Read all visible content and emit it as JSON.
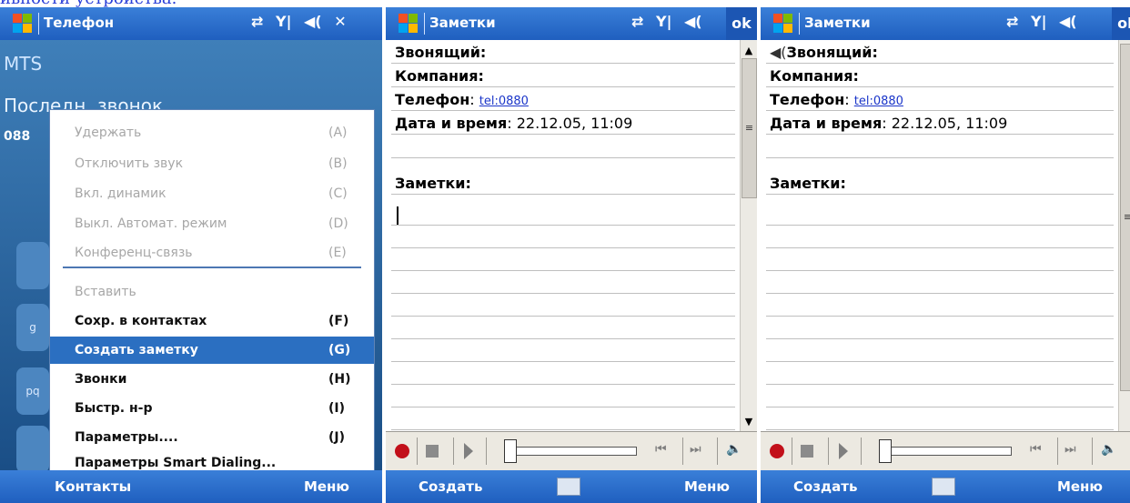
{
  "caption": "ивности устройства.",
  "screens": {
    "phone": {
      "title": "Телефон",
      "operator": "MTS",
      "last_calls": "Последн. звонок",
      "number_partial": "088",
      "keypad_chars": [
        "g",
        "pq"
      ],
      "menu": {
        "items": [
          {
            "label": "Удержать",
            "key": "(A)",
            "state": "disabled"
          },
          {
            "label": "Отключить звук",
            "key": "(B)",
            "state": "disabled"
          },
          {
            "label": "Вкл. динамик",
            "key": "(C)",
            "state": "disabled"
          },
          {
            "label": "Выкл. Автомат. режим",
            "key": "(D)",
            "state": "disabled"
          },
          {
            "label": "Конференц-связь",
            "key": "(E)",
            "state": "disabled"
          },
          {
            "label": "Вставить",
            "key": "",
            "state": "disabled"
          },
          {
            "label": "Сохр. в контактах",
            "key": "(F)",
            "state": "enabled"
          },
          {
            "label": "Создать заметку",
            "key": "(G)",
            "state": "selected"
          },
          {
            "label": "Звонки",
            "key": "(H)",
            "state": "enabled"
          },
          {
            "label": "Быстр. н-р",
            "key": "(I)",
            "state": "enabled"
          },
          {
            "label": "Параметры....",
            "key": "(J)",
            "state": "enabled"
          },
          {
            "label": "Параметры Smart Dialing...",
            "key": "",
            "state": "enabled"
          }
        ]
      },
      "softkeys": {
        "left": "Контакты",
        "right": "Меню"
      }
    },
    "notes1": {
      "title": "Заметки",
      "ok": "ok",
      "fields": {
        "caller": "Звонящий:",
        "company": "Компания:",
        "phone_label": "Телефон",
        "phone_link": "tel:0880",
        "datetime_label": "Дата и время",
        "datetime_value": "22.12.05, 11:09",
        "notes": "Заметки:"
      },
      "softkeys": {
        "left": "Создать",
        "right": "Меню"
      }
    },
    "notes2": {
      "title": "Заметки",
      "ok": "ok",
      "fields": {
        "caller": "Звонящий:",
        "company": "Компания:",
        "phone_label": "Телефон",
        "phone_link": "tel:0880",
        "datetime_label": "Дата и время",
        "datetime_value": "22.12.05, 11:09",
        "notes": "Заметки:"
      },
      "softkeys": {
        "left": "Создать",
        "right": "Меню"
      }
    }
  },
  "icons": {
    "windows": "windows-logo-icon",
    "sync": "sync-arrows-icon",
    "signal": "signal-icon",
    "speaker": "speaker-icon",
    "close": "close-icon",
    "keyboard": "keyboard-icon",
    "record": "record-icon",
    "stop": "stop-icon",
    "play": "play-icon",
    "prev": "previous-track-icon",
    "next": "next-track-icon",
    "volume": "volume-icon"
  },
  "colors": {
    "title_bar": "#2a6bcf",
    "selection": "#2b6fc1",
    "link": "#1a35c9",
    "record": "#c2101a"
  }
}
